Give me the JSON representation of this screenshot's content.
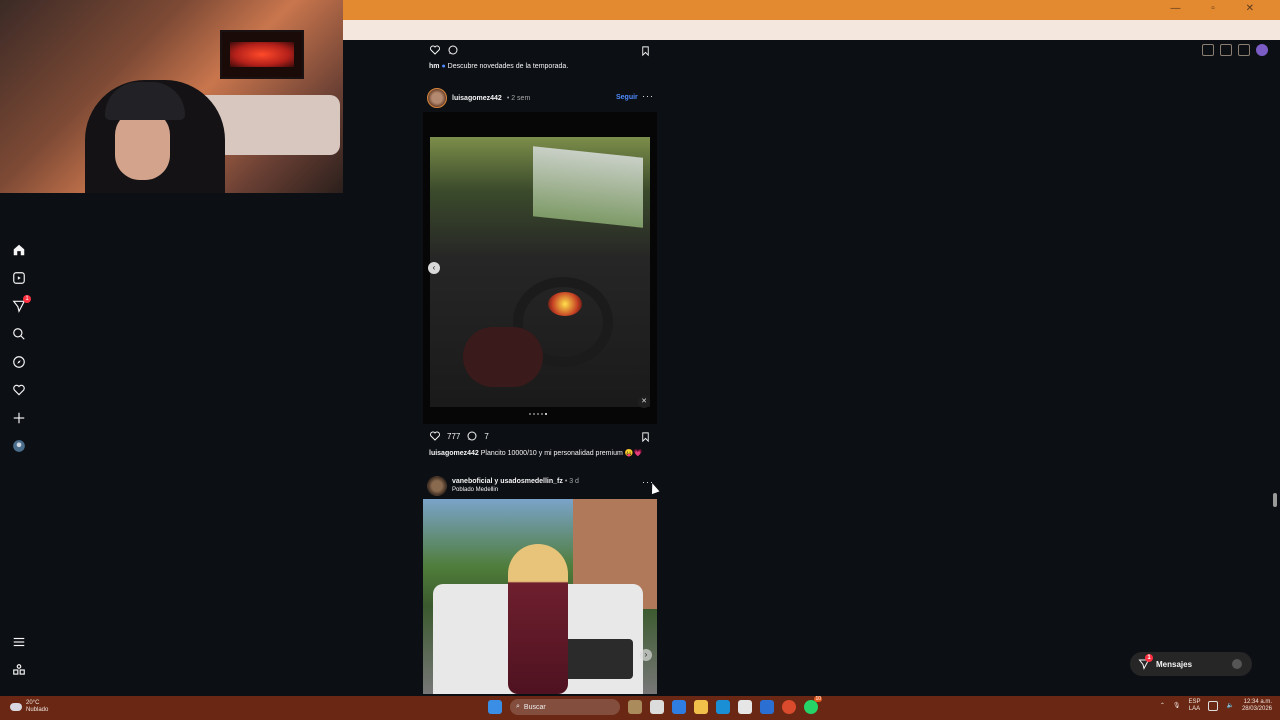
{
  "browser": {
    "window_controls": "— ▫ ✕"
  },
  "sidebar": {
    "items": [
      {
        "icon": "home-icon"
      },
      {
        "icon": "reels-icon"
      },
      {
        "icon": "direct-icon",
        "badge": "1"
      },
      {
        "icon": "search-icon"
      },
      {
        "icon": "explore-icon"
      },
      {
        "icon": "heart-icon"
      },
      {
        "icon": "create-icon"
      },
      {
        "icon": "profile-icon"
      }
    ],
    "bottom": [
      {
        "icon": "menu-icon"
      },
      {
        "icon": "threads-icon"
      }
    ]
  },
  "feed": {
    "top_post": {
      "caption_user": "hm",
      "caption_text": "Descubre novedades de la temporada."
    },
    "post1": {
      "username": "luisagomez442",
      "time": "• 2 sem",
      "follow": "Seguir",
      "likes": "777",
      "comments": "7",
      "caption_user": "luisagomez442",
      "caption_text": "Plancito 10000/10 y mi personalidad premium 😛💗"
    },
    "post2": {
      "username": "vaneboficial y usadosmedellin_fz",
      "time": "• 3 d",
      "location": "Poblado Medellin"
    }
  },
  "messages": {
    "label": "Mensajes",
    "badge": "1"
  },
  "taskbar": {
    "weather_temp": "20°C",
    "weather_desc": "Nublado",
    "search_placeholder": "Buscar",
    "lang_1": "ESP",
    "lang_2": "LAA",
    "time": "12:34 a.m.",
    "date": "28/03/2026",
    "whatsapp_badge": "10"
  },
  "colors": {
    "accent_follow": "#4f8cff",
    "badge_red": "#ff3040",
    "chrome_orange": "#e3892f",
    "taskbar": "#6a2814"
  }
}
